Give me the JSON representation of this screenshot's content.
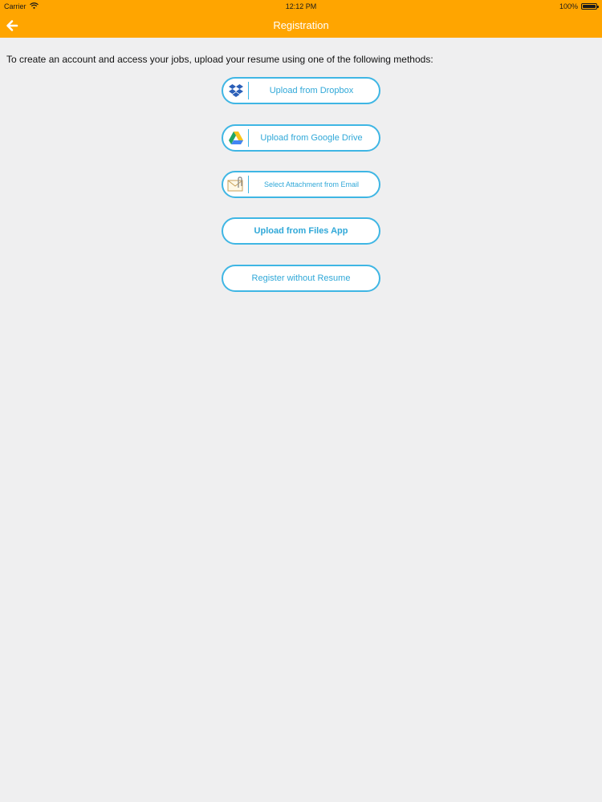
{
  "status_bar": {
    "carrier": "Carrier",
    "time": "12:12 PM",
    "battery": "100%",
    "battery_level": 1.0
  },
  "nav": {
    "title": "Registration",
    "back_icon": "arrow-left-icon"
  },
  "intro": {
    "text": "To create an account and access your jobs, upload your resume using one of the following methods:"
  },
  "buttons": {
    "dropbox": "Upload from Dropbox",
    "google_drive": "Upload from Google Drive",
    "email": "Select Attachment from Email",
    "files_app": "Upload from Files App",
    "no_resume": "Register without Resume"
  },
  "colors": {
    "header": "#ffa500",
    "accent": "#3fb6e4",
    "background": "#efeff0"
  }
}
